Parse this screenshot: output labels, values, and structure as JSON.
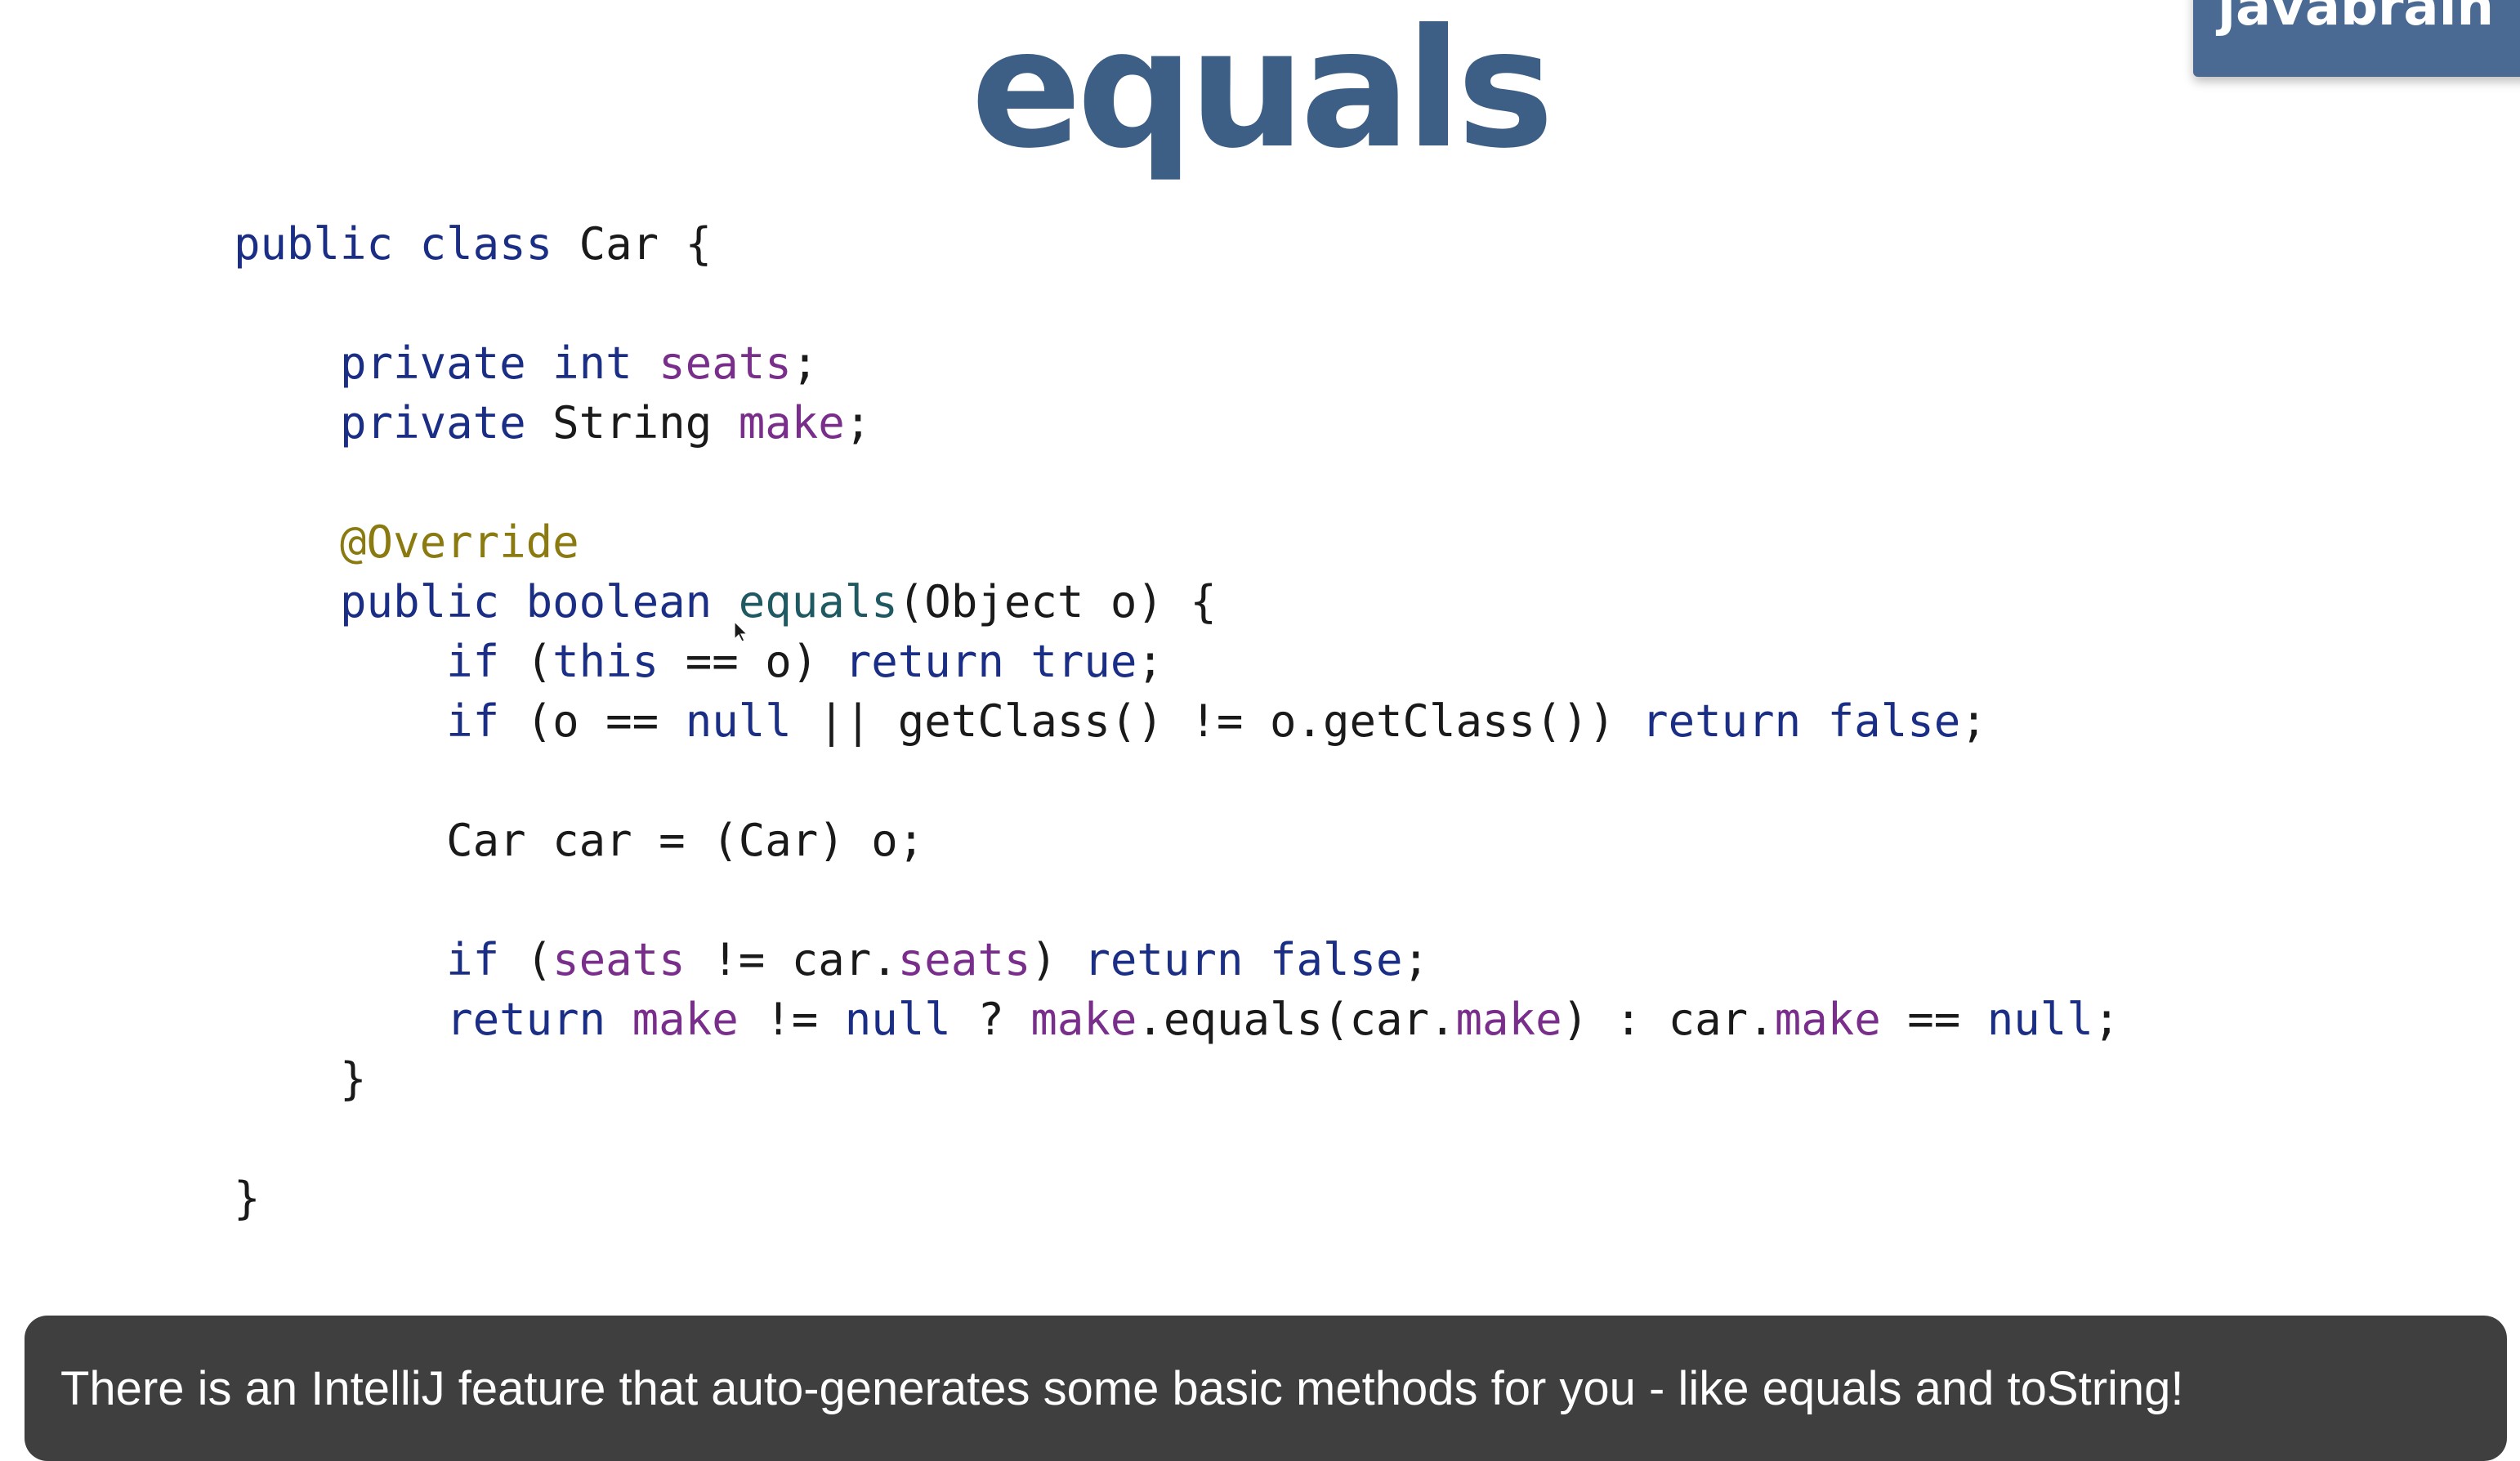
{
  "slide": {
    "title": "equals",
    "brand_badge": "javabrain",
    "caption": "There is an IntelliJ feature that auto-generates some basic methods for you - like equals and toString!"
  },
  "code": {
    "lines": [
      [
        {
          "t": "public class ",
          "c": "kw"
        },
        {
          "t": "Car {",
          "c": "pl"
        }
      ],
      [],
      [
        {
          "t": "    private int ",
          "c": "kw"
        },
        {
          "t": "seats",
          "c": "fld"
        },
        {
          "t": ";",
          "c": "pl"
        }
      ],
      [
        {
          "t": "    private ",
          "c": "kw"
        },
        {
          "t": "String ",
          "c": "pl"
        },
        {
          "t": "make",
          "c": "fld"
        },
        {
          "t": ";",
          "c": "pl"
        }
      ],
      [],
      [
        {
          "t": "    @Override",
          "c": "ann"
        }
      ],
      [
        {
          "t": "    public boolean ",
          "c": "kw"
        },
        {
          "t": "equals",
          "c": "mth"
        },
        {
          "t": "(Object o) {",
          "c": "pl"
        }
      ],
      [
        {
          "t": "        if ",
          "c": "kw"
        },
        {
          "t": "(",
          "c": "pl"
        },
        {
          "t": "this",
          "c": "kw"
        },
        {
          "t": " == o) ",
          "c": "pl"
        },
        {
          "t": "return true",
          "c": "kw"
        },
        {
          "t": ";",
          "c": "pl"
        }
      ],
      [
        {
          "t": "        if ",
          "c": "kw"
        },
        {
          "t": "(o == ",
          "c": "pl"
        },
        {
          "t": "null",
          "c": "kw"
        },
        {
          "t": " || getClass() != o.getClass()) ",
          "c": "pl"
        },
        {
          "t": "return false",
          "c": "kw"
        },
        {
          "t": ";",
          "c": "pl"
        }
      ],
      [],
      [
        {
          "t": "        Car car = (Car) o;",
          "c": "pl"
        }
      ],
      [],
      [
        {
          "t": "        if ",
          "c": "kw"
        },
        {
          "t": "(",
          "c": "pl"
        },
        {
          "t": "seats",
          "c": "fld"
        },
        {
          "t": " != car.",
          "c": "pl"
        },
        {
          "t": "seats",
          "c": "fld"
        },
        {
          "t": ") ",
          "c": "pl"
        },
        {
          "t": "return false",
          "c": "kw"
        },
        {
          "t": ";",
          "c": "pl"
        }
      ],
      [
        {
          "t": "        return ",
          "c": "kw"
        },
        {
          "t": "make",
          "c": "fld"
        },
        {
          "t": " != ",
          "c": "pl"
        },
        {
          "t": "null",
          "c": "kw"
        },
        {
          "t": " ? ",
          "c": "pl"
        },
        {
          "t": "make",
          "c": "fld"
        },
        {
          "t": ".equals(car.",
          "c": "pl"
        },
        {
          "t": "make",
          "c": "fld"
        },
        {
          "t": ") : car.",
          "c": "pl"
        },
        {
          "t": "make",
          "c": "fld"
        },
        {
          "t": " == ",
          "c": "pl"
        },
        {
          "t": "null",
          "c": "kw"
        },
        {
          "t": ";",
          "c": "pl"
        }
      ],
      [
        {
          "t": "    }",
          "c": "pl"
        }
      ],
      [],
      [
        {
          "t": "}",
          "c": "pl"
        }
      ]
    ]
  },
  "colors": {
    "title": "#3d5f85",
    "keyword": "#1a2e86",
    "field": "#7a2e8c",
    "annotation": "#8a7a10",
    "method": "#1f5a63",
    "caption_background": "#3f3f3f",
    "badge_background": "#4a6a93"
  },
  "icons": {
    "pointer": "mouse-pointer-icon"
  }
}
